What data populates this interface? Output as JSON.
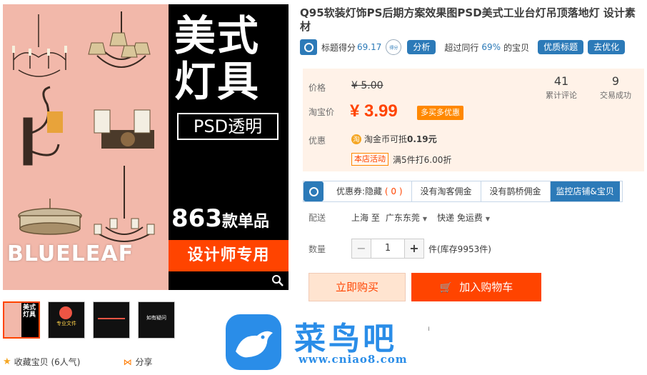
{
  "product_image": {
    "title_line1": "美式",
    "title_line2": "灯具",
    "psd_label": "PSD透明",
    "count_num": "863",
    "count_suffix": "款单品",
    "designer_label": "设计师专用",
    "brand": "BLUELEAF"
  },
  "thumbnails": [
    {
      "text": "美式灯具"
    },
    {
      "text": "专业文件"
    },
    {
      "text": ""
    },
    {
      "text": "如有疑问"
    }
  ],
  "bottom_actions": {
    "favorite_label": "收藏宝贝 (6人气)",
    "share_label": "分享"
  },
  "product": {
    "title": "Q95软装灯饰PS后期方案效果图PSD美式工业台灯吊顶落地灯 设计素材"
  },
  "score": {
    "label": "标题得分",
    "value": "69.17",
    "badge_text": "得分",
    "analyze_label": "分析",
    "compare_prefix": "超过同行",
    "compare_pct": "69%",
    "compare_suffix": "的宝贝",
    "quality_label": "优质标题",
    "optimize_label": "去优化"
  },
  "price": {
    "price_label": "价格",
    "original": "¥ 5.00",
    "taobao_label": "淘宝价",
    "current": "¥ 3.99",
    "buy_tag": "多买多优惠",
    "reviews_count": "41",
    "reviews_label": "累计评论",
    "sales_count": "9",
    "sales_label": "交易成功",
    "discount_label": "优惠",
    "coin_text": "淘金币可抵",
    "coin_amount": "0.19元",
    "coin_glyph": "淘",
    "promo_tag": "本店活动",
    "promo_text": "满5件打6.00折"
  },
  "tools": {
    "coupon_label": "优惠券:隐藏",
    "coupon_count": "( 0 )",
    "no_taoke": "没有淘客佣金",
    "no_bridge": "没有鹊桥佣金",
    "monitor": "监控店铺&宝贝"
  },
  "shipping": {
    "label": "配送",
    "from": "上海 至",
    "to": "广东东莞",
    "method": "快递 免运费"
  },
  "quantity": {
    "label": "数量",
    "value": "1",
    "stock": "件(库存9953件)"
  },
  "actions": {
    "buy_now": "立即购买",
    "add_cart": "加入购物车"
  },
  "qr_stub": "h",
  "watermark": {
    "text": "菜鸟吧",
    "url": "www.cniao8.com"
  },
  "colors": {
    "accent": "#ff4400",
    "blue": "#2c7ab8",
    "price_bg": "#fff2e8",
    "image_bg": "#f2b8aa"
  }
}
